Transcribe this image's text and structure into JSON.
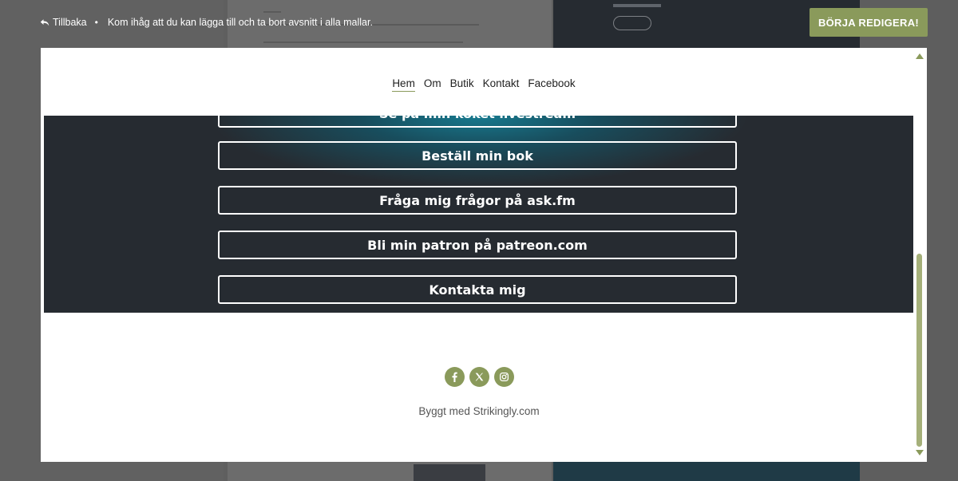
{
  "topbar": {
    "back_label": "Tillbaka",
    "separator": "•",
    "hint": "Kom ihåg att du kan lägga till och ta bort avsnitt i alla mallar.",
    "edit_label": "BÖRJA REDIGERA!"
  },
  "nav": {
    "items": [
      {
        "label": "Hem"
      },
      {
        "label": "Om"
      },
      {
        "label": "Butik"
      },
      {
        "label": "Kontakt"
      },
      {
        "label": "Facebook"
      }
    ]
  },
  "links": {
    "items": [
      {
        "label": "Se på min koket livestream"
      },
      {
        "label": "Beställ min bok"
      },
      {
        "label": "Fråga mig frågor på ask.fm"
      },
      {
        "label": "Bli min patron på patreon.com"
      },
      {
        "label": "Kontakta mig"
      }
    ]
  },
  "footer": {
    "socials": [
      {
        "icon": "facebook-icon"
      },
      {
        "icon": "x-twitter-icon"
      },
      {
        "icon": "instagram-icon"
      }
    ],
    "built_with": "Byggt med Strikingly.com"
  },
  "colors": {
    "accent": "#8a9a5b",
    "hero_bg": "#262b31",
    "hero_glow": "#167e94"
  }
}
